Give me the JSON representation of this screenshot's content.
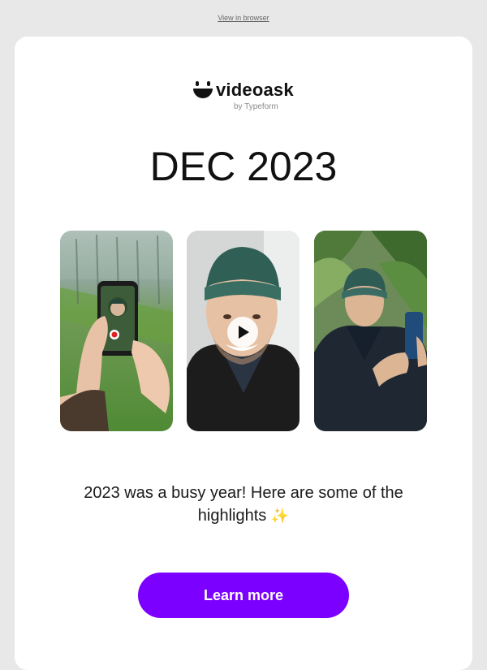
{
  "header": {
    "view_in_browser": "View in browser"
  },
  "logo": {
    "name": "videoask",
    "sub": "by Typeform",
    "icon": "smiley-logo-icon"
  },
  "headline": "DEC 2023",
  "photos": [
    {
      "name": "photo-phone-recording",
      "icon": "record-icon"
    },
    {
      "name": "photo-man-beanie-smiling",
      "icon": "play-icon"
    },
    {
      "name": "photo-man-phone-plants"
    }
  ],
  "body": {
    "text": "2023 was a busy year! Here are some of the highlights",
    "emoji": "✨"
  },
  "cta": {
    "label": "Learn more"
  },
  "colors": {
    "accent": "#7b00ff",
    "background": "#e8e8e8",
    "card": "#ffffff"
  }
}
